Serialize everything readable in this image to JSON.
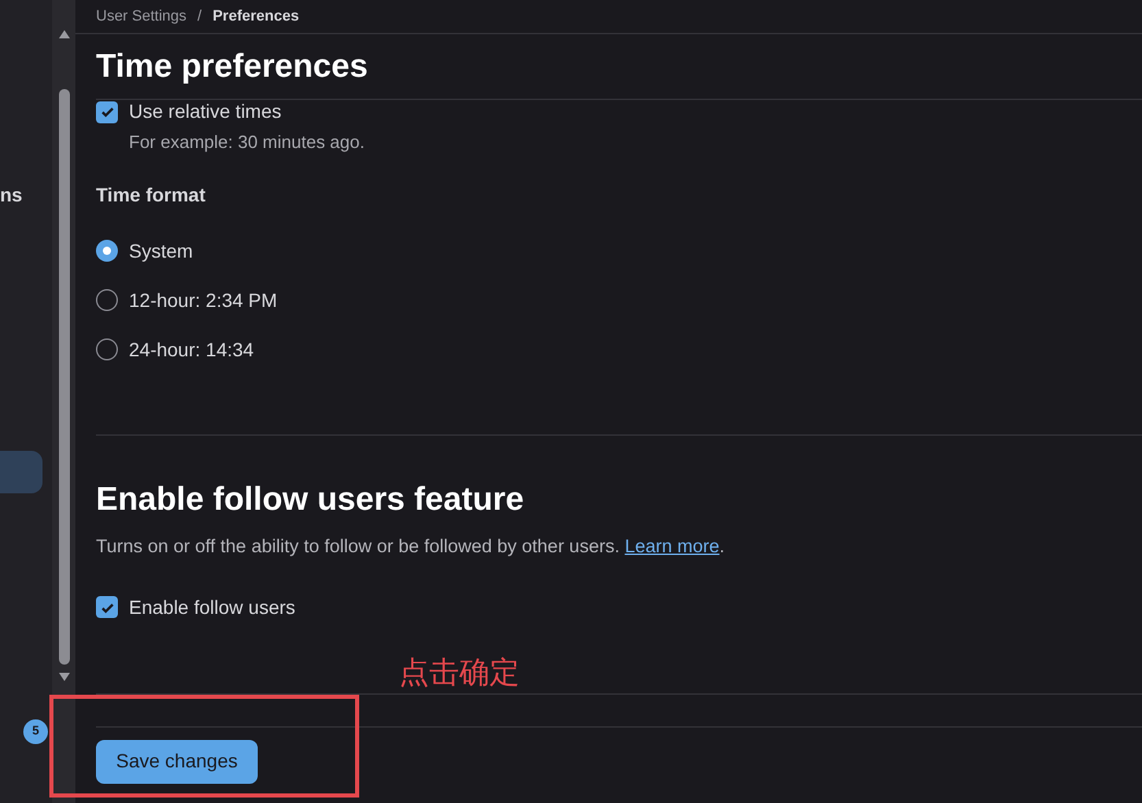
{
  "breadcrumb": {
    "parent": "User Settings",
    "separator": "/",
    "current": "Preferences"
  },
  "sidebar": {
    "items": [
      {
        "label": "ns",
        "selected": false
      },
      {
        "selected": true
      }
    ],
    "badge": "5"
  },
  "time_preferences": {
    "title": "Time preferences",
    "relative": {
      "label": "Use relative times",
      "hint": "For example: 30 minutes ago.",
      "checked": true
    },
    "time_format": {
      "label": "Time format",
      "options": [
        {
          "label": "System",
          "selected": true
        },
        {
          "label": "12-hour: 2:34 PM",
          "selected": false
        },
        {
          "label": "24-hour: 14:34",
          "selected": false
        }
      ]
    }
  },
  "follow_users": {
    "title": "Enable follow users feature",
    "description": "Turns on or off the ability to follow or be followed by other users.",
    "link": "Learn more",
    "link_suffix": ".",
    "checkbox": {
      "label": "Enable follow users",
      "checked": true
    }
  },
  "annotation": "点击确定",
  "save_button": "Save changes"
}
